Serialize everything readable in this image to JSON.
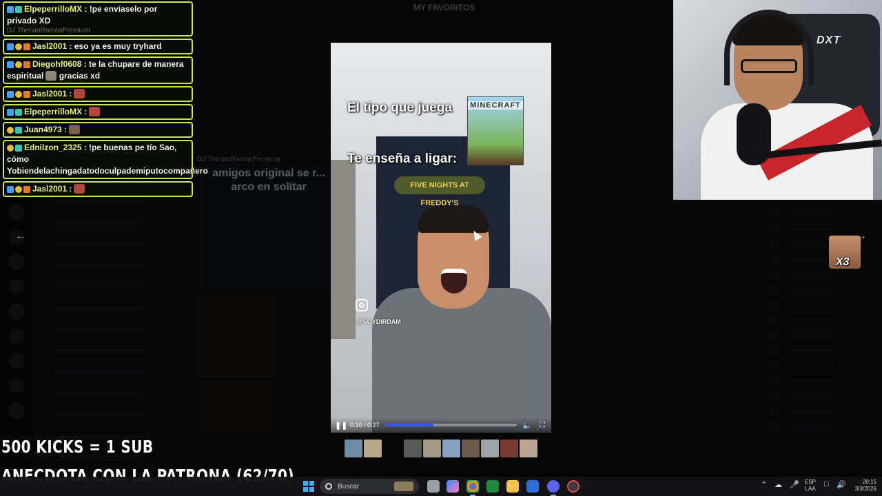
{
  "background": {
    "top_text": "MY FAVORITOS",
    "title_text": "amigos original se r... arco en solitar",
    "dj_label_top": "DJ TherianRamosPremium",
    "dj_label_mid": "DJ TherianRamosPremium"
  },
  "chat": {
    "messages": [
      {
        "badges": [
          "b-blue",
          "b-teal"
        ],
        "name": "ElpeperrilloMX",
        "text": " : !pe envíaselo por privado XD",
        "sub": "DJ TherianRamosPremium",
        "emote": ""
      },
      {
        "badges": [
          "b-blue",
          "b-yel",
          "b-org"
        ],
        "name": "Jasl2001",
        "text": " : eso ya es muy tryhard",
        "sub": "",
        "emote": ""
      },
      {
        "badges": [
          "b-blue",
          "b-yel",
          "b-org"
        ],
        "name": "Diegohf0608",
        "text": " : te la chupare de manera espiritual",
        "sub": "",
        "emote": "em-gray",
        "after_emote": " gracias xd"
      },
      {
        "badges": [
          "b-blue",
          "b-yel",
          "b-org"
        ],
        "name": "Jasl2001",
        "text": " :",
        "sub": "",
        "emote": "em-red"
      },
      {
        "badges": [
          "b-blue",
          "b-teal"
        ],
        "name": "ElpeperrilloMX",
        "text": " :",
        "sub": "",
        "emote": "em-red"
      },
      {
        "badges": [
          "b-yel",
          "b-teal"
        ],
        "name": "Juan4973",
        "text": " :",
        "sub": "",
        "emote": "em-brown"
      },
      {
        "badges": [
          "b-yel",
          "b-teal"
        ],
        "name": "Ednilzon_2325",
        "text": " : !pe buenas pe tío Sao, cómo Yobiendelachingadatodoculpademiputocompañero",
        "sub": "",
        "emote": ""
      },
      {
        "badges": [
          "b-blue",
          "b-yel",
          "b-org"
        ],
        "name": "Jasl2001",
        "text": " :",
        "sub": "",
        "emote": "em-red"
      }
    ]
  },
  "video": {
    "caption_top": "El tipo que juega",
    "caption_bottom": "Te enseña a ligar:",
    "game_logo": "MINECRAFT",
    "poster_text": "FIVE NIGHTS AT FREDDY'S",
    "handle": "@SOYDIRDAM",
    "time_display": "0:10 / 0:27",
    "progress_fraction": 0.37,
    "pause_icon": "pause-icon",
    "volume_icon": "volume-icon",
    "fullscreen_icon": "fullscreen-icon"
  },
  "webcam": {
    "chair_brand": "DXT"
  },
  "reaction": {
    "count": "X3"
  },
  "overlay": {
    "line1": "500 KICKS = 1 SUB",
    "line2": "ANECDOTA CON LA PATRONA (62/70)"
  },
  "taskbar": {
    "search_label": "Buscar",
    "lang_top": "ESP",
    "lang_bottom": "LAA",
    "time": "20:15",
    "date": "3/3/2026"
  },
  "thumb_colors": [
    "#6f8aa3",
    "#b7a88a",
    "#555a54",
    "#a39785",
    "#8aa0c2",
    "#6b5a4a",
    "#9da2a8",
    "#7a3a34",
    "#b8a690"
  ]
}
